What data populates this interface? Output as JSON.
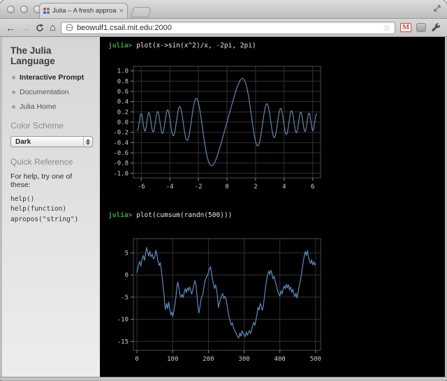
{
  "browser": {
    "window_controls": [
      "close",
      "minimize",
      "zoom"
    ],
    "tab_title": "Julia – A fresh approach to t",
    "tab_close_icon": "×",
    "url": "beowulf1.csail.mit.edu:2000",
    "icons": {
      "back": "←",
      "forward": "→",
      "home": "⌂",
      "star": "☆"
    }
  },
  "sidebar": {
    "title": "The Julia Language",
    "nav": [
      {
        "label": "Interactive Prompt",
        "active": true
      },
      {
        "label": "Documentation",
        "active": false
      },
      {
        "label": "Julia Home",
        "active": false
      }
    ],
    "color_scheme_heading": "Color Scheme",
    "color_scheme_selected": "Dark",
    "quick_reference_heading": "Quick Reference",
    "quick_reference_intro": "For help, try one of these:",
    "quick_reference_examples": "help()\nhelp(function)\napropos(\"string\")"
  },
  "terminal": {
    "prompt_label": "julia>",
    "lines": [
      {
        "command": "plot(x->sin(x^2)/x, -2pi, 2pi)"
      },
      {
        "command": "plot(cumsum(randn(500)))"
      }
    ],
    "colors": {
      "background": "#000000",
      "prompt": "#36a236",
      "text": "#e8e8e8",
      "grid": "#333333",
      "frame": "#4d4d4d",
      "tick": "#8a8a8a",
      "tick_label": "#cccccc"
    }
  },
  "chart_data": [
    {
      "type": "line",
      "title": "",
      "source_command": "plot(x->sin(x^2)/x, -2pi, 2pi)",
      "function": "sin(x^2)/x",
      "js_expr": "Math.sin(x*x)/(x===0?1e-9:x)",
      "x_range": [
        -6.2832,
        6.2832
      ],
      "samples": 700,
      "xlim": [
        -6.55,
        6.55
      ],
      "ylim": [
        -1.09,
        1.09
      ],
      "xticks": [
        -6,
        -4,
        -2,
        0,
        2,
        4,
        6
      ],
      "xtick_labels": [
        "-6",
        "-4",
        "-2",
        "0",
        "2",
        "4",
        "6"
      ],
      "yticks": [
        -1,
        -0.8,
        -0.6,
        -0.4,
        -0.2,
        0,
        0.2,
        0.4,
        0.6,
        0.8,
        1
      ],
      "ytick_labels": [
        "-1.0",
        "-0.8",
        "-0.6",
        "-0.4",
        "-0.2",
        "0.0",
        "0.2",
        "0.4",
        "0.6",
        "0.8",
        "1.0"
      ],
      "grid": true,
      "line_color": "#6288ab"
    },
    {
      "type": "line",
      "title": "",
      "source_command": "plot(cumsum(randn(500)))",
      "series": "cumsum(randn(500)) random walk (values estimated from pixels)",
      "keypoints": [
        [
          0,
          0.6
        ],
        [
          4,
          2.2
        ],
        [
          8,
          3.1
        ],
        [
          11,
          2.0
        ],
        [
          14,
          3.4
        ],
        [
          18,
          4.4
        ],
        [
          21,
          3.3
        ],
        [
          24,
          4.8
        ],
        [
          27,
          6.2
        ],
        [
          30,
          5.1
        ],
        [
          33,
          4.3
        ],
        [
          36,
          5.4
        ],
        [
          39,
          4.1
        ],
        [
          43,
          4.7
        ],
        [
          46,
          3.6
        ],
        [
          50,
          4.2
        ],
        [
          53,
          5.6
        ],
        [
          56,
          4.4
        ],
        [
          59,
          3.0
        ],
        [
          62,
          2.1
        ],
        [
          65,
          2.8
        ],
        [
          68,
          1.2
        ],
        [
          71,
          -0.8
        ],
        [
          73,
          -2.6
        ],
        [
          76,
          -4.6
        ],
        [
          78,
          -6.9
        ],
        [
          80,
          -7.8
        ],
        [
          83,
          -6.4
        ],
        [
          86,
          -7.6
        ],
        [
          89,
          -6.1
        ],
        [
          92,
          -7.9
        ],
        [
          95,
          -9.0
        ],
        [
          98,
          -8.4
        ],
        [
          100,
          -9.4
        ],
        [
          103,
          -8.2
        ],
        [
          106,
          -6.8
        ],
        [
          109,
          -4.9
        ],
        [
          112,
          -2.6
        ],
        [
          114,
          -1.6
        ],
        [
          117,
          -2.8
        ],
        [
          120,
          -4.3
        ],
        [
          123,
          -5.0
        ],
        [
          126,
          -4.4
        ],
        [
          129,
          -5.1
        ],
        [
          132,
          -4.0
        ],
        [
          135,
          -3.1
        ],
        [
          138,
          -4.0
        ],
        [
          141,
          -2.9
        ],
        [
          144,
          -3.6
        ],
        [
          147,
          -2.7
        ],
        [
          150,
          -3.3
        ],
        [
          153,
          -4.3
        ],
        [
          156,
          -3.4
        ],
        [
          159,
          -2.4
        ],
        [
          162,
          -1.3
        ],
        [
          165,
          -2.2
        ],
        [
          168,
          -4.6
        ],
        [
          170,
          -6.7
        ],
        [
          173,
          -8.6
        ],
        [
          176,
          -7.4
        ],
        [
          179,
          -5.6
        ],
        [
          182,
          -4.8
        ],
        [
          185,
          -4.2
        ],
        [
          188,
          -2.4
        ],
        [
          191,
          -1.2
        ],
        [
          194,
          -0.6
        ],
        [
          197,
          -0.1
        ],
        [
          200,
          0.5
        ],
        [
          203,
          1.4
        ],
        [
          206,
          1.9
        ],
        [
          208,
          0.7
        ],
        [
          211,
          -0.7
        ],
        [
          214,
          -2.1
        ],
        [
          217,
          -3.1
        ],
        [
          220,
          -2.2
        ],
        [
          223,
          -3.3
        ],
        [
          226,
          -5.6
        ],
        [
          228,
          -7.4
        ],
        [
          231,
          -6.2
        ],
        [
          234,
          -5.4
        ],
        [
          237,
          -4.6
        ],
        [
          240,
          -4.2
        ],
        [
          243,
          -5.3
        ],
        [
          246,
          -4.8
        ],
        [
          249,
          -5.4
        ],
        [
          252,
          -6.6
        ],
        [
          255,
          -8.2
        ],
        [
          258,
          -9.6
        ],
        [
          261,
          -10.4
        ],
        [
          264,
          -11.3
        ],
        [
          267,
          -10.8
        ],
        [
          270,
          -11.9
        ],
        [
          273,
          -12.4
        ],
        [
          276,
          -12.9
        ],
        [
          279,
          -13.4
        ],
        [
          282,
          -13.9
        ],
        [
          285,
          -14.2
        ],
        [
          288,
          -13.1
        ],
        [
          291,
          -13.8
        ],
        [
          294,
          -12.6
        ],
        [
          297,
          -13.2
        ],
        [
          300,
          -13.5
        ],
        [
          303,
          -13.9
        ],
        [
          306,
          -12.9
        ],
        [
          309,
          -13.6
        ],
        [
          312,
          -13.0
        ],
        [
          315,
          -12.5
        ],
        [
          318,
          -13.2
        ],
        [
          321,
          -12.4
        ],
        [
          324,
          -11.4
        ],
        [
          327,
          -10.7
        ],
        [
          330,
          -11.4
        ],
        [
          333,
          -10.2
        ],
        [
          336,
          -8.9
        ],
        [
          339,
          -7.3
        ],
        [
          342,
          -7.9
        ],
        [
          345,
          -6.4
        ],
        [
          348,
          -7.1
        ],
        [
          351,
          -8.0
        ],
        [
          354,
          -6.7
        ],
        [
          357,
          -4.9
        ],
        [
          360,
          -2.8
        ],
        [
          363,
          -1.1
        ],
        [
          366,
          0.2
        ],
        [
          369,
          0.9
        ],
        [
          372,
          0.1
        ],
        [
          375,
          1.1
        ],
        [
          378,
          0.2
        ],
        [
          381,
          -0.9
        ],
        [
          384,
          -0.3
        ],
        [
          387,
          -1.4
        ],
        [
          390,
          -2.3
        ],
        [
          393,
          -3.3
        ],
        [
          396,
          -4.1
        ],
        [
          400,
          -4.8
        ],
        [
          403,
          -3.6
        ],
        [
          406,
          -4.3
        ],
        [
          409,
          -3.2
        ],
        [
          412,
          -2.5
        ],
        [
          415,
          -3.1
        ],
        [
          418,
          -2.1
        ],
        [
          421,
          -2.9
        ],
        [
          424,
          -2.2
        ],
        [
          427,
          -3.4
        ],
        [
          430,
          -2.7
        ],
        [
          433,
          -3.9
        ],
        [
          436,
          -3.2
        ],
        [
          439,
          -4.2
        ],
        [
          442,
          -4.9
        ],
        [
          445,
          -4.1
        ],
        [
          448,
          -5.2
        ],
        [
          451,
          -3.9
        ],
        [
          454,
          -2.6
        ],
        [
          457,
          -1.4
        ],
        [
          460,
          -0.2
        ],
        [
          463,
          1.6
        ],
        [
          466,
          3.2
        ],
        [
          469,
          4.6
        ],
        [
          471,
          5.3
        ],
        [
          474,
          4.4
        ],
        [
          477,
          5.5
        ],
        [
          480,
          4.1
        ],
        [
          483,
          3.2
        ],
        [
          486,
          2.6
        ],
        [
          489,
          3.4
        ],
        [
          492,
          2.3
        ],
        [
          495,
          3.0
        ],
        [
          498,
          2.2
        ],
        [
          500,
          2.6
        ]
      ],
      "xlim": [
        -10,
        514
      ],
      "ylim": [
        -17,
        8.2
      ],
      "xticks": [
        0,
        100,
        200,
        300,
        400,
        500
      ],
      "xtick_labels": [
        "0",
        "100",
        "200",
        "300",
        "400",
        "500"
      ],
      "yticks": [
        5,
        0,
        -5,
        -10,
        -15
      ],
      "ytick_labels": [
        "5",
        "0",
        "-5",
        "-10",
        "-15"
      ],
      "grid": true,
      "line_color": "#5b8ac0"
    }
  ]
}
